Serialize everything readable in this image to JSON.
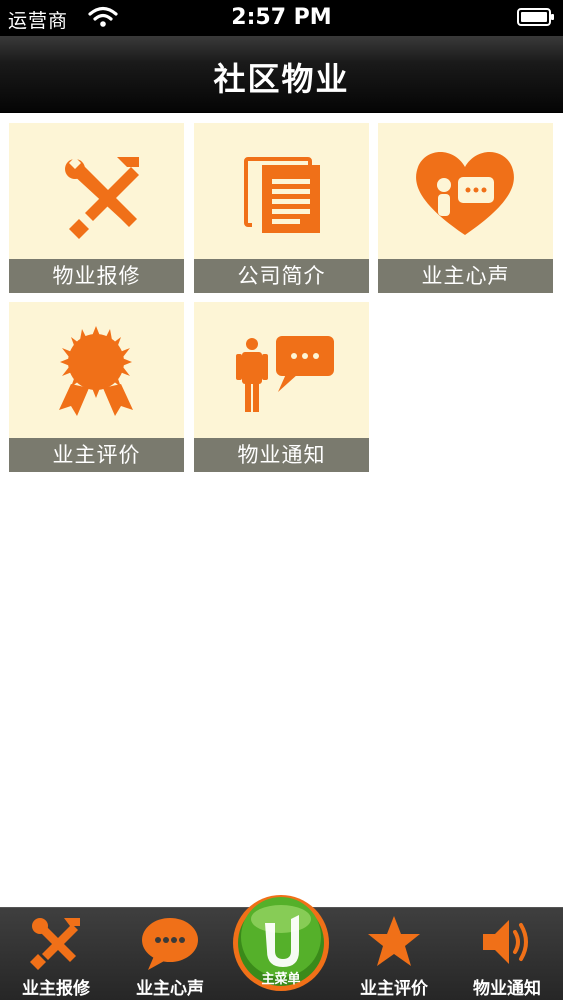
{
  "status_bar": {
    "carrier": "运营商",
    "time": "2:57 PM"
  },
  "nav": {
    "title": "社区物业"
  },
  "colors": {
    "accent": "#f07018",
    "tile_bg": "#fdf5d6",
    "label_bg": "#7a7a6e"
  },
  "tiles": [
    {
      "label": "物业报修",
      "icon": "repair-tools-icon"
    },
    {
      "label": "公司简介",
      "icon": "document-icon"
    },
    {
      "label": "业主心声",
      "icon": "heart-chat-icon"
    },
    {
      "label": "业主评价",
      "icon": "award-ribbon-icon"
    },
    {
      "label": "物业通知",
      "icon": "person-speech-icon"
    }
  ],
  "tab_bar": {
    "items": [
      {
        "label": "业主报修",
        "icon": "repair-tools-icon"
      },
      {
        "label": "业主心声",
        "icon": "chat-bubble-icon"
      },
      {
        "label": "业主评价",
        "icon": "star-icon"
      },
      {
        "label": "物业通知",
        "icon": "speaker-icon"
      }
    ],
    "home": {
      "label": "主菜单",
      "icon": "home-logo-icon"
    }
  }
}
